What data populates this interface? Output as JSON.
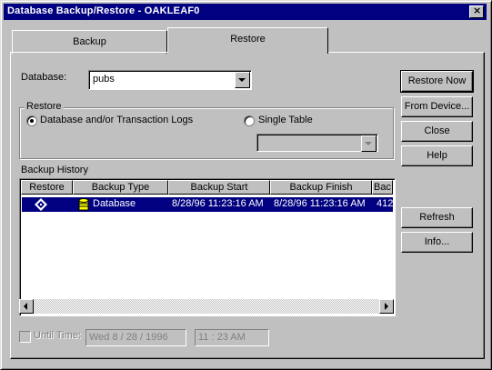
{
  "window": {
    "title": "Database Backup/Restore - OAKLEAF0"
  },
  "tabs": [
    {
      "label": "Backup"
    },
    {
      "label": "Restore"
    }
  ],
  "database": {
    "label": "Database:",
    "value": "pubs"
  },
  "restore_group": {
    "title": "Restore",
    "option_logs": "Database and/or Transaction Logs",
    "option_table": "Single Table"
  },
  "history": {
    "label": "Backup History",
    "columns": [
      "Restore",
      "Backup Type",
      "Backup Start",
      "Backup Finish",
      "Bac"
    ],
    "rows": [
      {
        "type": "Database",
        "start": "8/28/96 11:23:16 AM",
        "finish": "8/28/96 11:23:16 AM",
        "size": "412"
      }
    ]
  },
  "buttons": {
    "restore_now": "Restore Now",
    "from_device": "From Device...",
    "close": "Close",
    "help": "Help",
    "refresh": "Refresh",
    "info": "Info..."
  },
  "until": {
    "label": "Until Time:",
    "date": "Wed 8  / 28 / 1996",
    "time": "11 : 23  AM"
  }
}
